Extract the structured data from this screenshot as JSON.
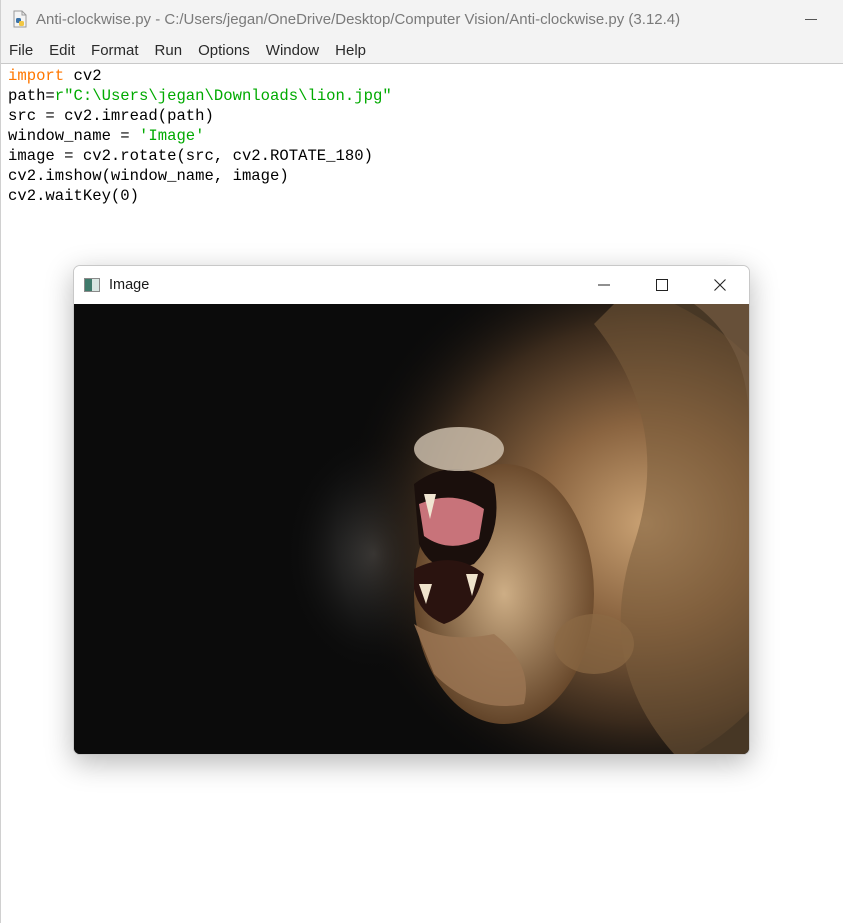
{
  "idle": {
    "title": "Anti-clockwise.py - C:/Users/jegan/OneDrive/Desktop/Computer Vision/Anti-clockwise.py (3.12.4)",
    "menu": [
      "File",
      "Edit",
      "Format",
      "Run",
      "Options",
      "Window",
      "Help"
    ]
  },
  "code_lines": [
    [
      {
        "t": "import",
        "c": "kw"
      },
      {
        "t": " cv2",
        "c": ""
      }
    ],
    [
      {
        "t": "path=",
        "c": ""
      },
      {
        "t": "r\"C:\\Users\\jegan\\Downloads\\lion.jpg\"",
        "c": "str"
      }
    ],
    [
      {
        "t": "src = cv2.imread(path)",
        "c": ""
      }
    ],
    [
      {
        "t": "window_name = ",
        "c": ""
      },
      {
        "t": "'Image'",
        "c": "str"
      }
    ],
    [
      {
        "t": "image = cv2.rotate(src, cv2.ROTATE_180)",
        "c": ""
      }
    ],
    [
      {
        "t": "cv2.imshow(window_name, image)",
        "c": ""
      }
    ],
    [
      {
        "t": "cv2.waitKey(0)",
        "c": ""
      }
    ]
  ],
  "colors": {
    "keyword": "#ff7700",
    "string": "#00aa00",
    "titlebar_bg": "#f3f3f3"
  },
  "image_window": {
    "title": "Image",
    "image_subject": "lion-roaring-rotated-180"
  }
}
